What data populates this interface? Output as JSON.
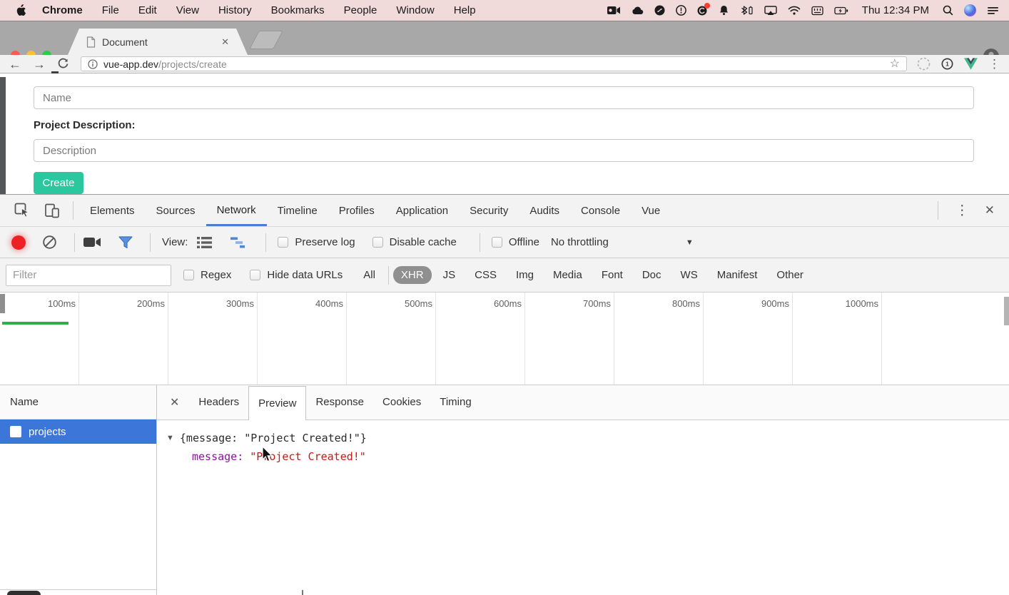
{
  "menubar": {
    "items": [
      "Chrome",
      "File",
      "Edit",
      "View",
      "History",
      "Bookmarks",
      "People",
      "Window",
      "Help"
    ],
    "time": "Thu 12:34 PM",
    "status_icons": [
      "screen-record-icon",
      "cloud-icon",
      "shazam-icon",
      "alert-circle-icon",
      "app-badge-icon",
      "bell-icon",
      "bluetooth-battery-icon",
      "airplay-display-icon",
      "wifi-icon",
      "keyboard-icon",
      "battery-charging-icon",
      "spotlight-search-icon",
      "siri-icon",
      "notification-center-icon"
    ]
  },
  "browser": {
    "tab_title": "Document",
    "url_host": "vue-app.dev",
    "url_path": "/projects/create"
  },
  "page": {
    "name_placeholder": "Name",
    "description_label": "Project Description:",
    "description_placeholder": "Description",
    "create_button": "Create",
    "create_button_color": "#2bc79e"
  },
  "devtools": {
    "tabs": [
      "Elements",
      "Sources",
      "Network",
      "Timeline",
      "Profiles",
      "Application",
      "Security",
      "Audits",
      "Console",
      "Vue"
    ],
    "active_tab": "Network",
    "active_tab_underline_color": "#4c7dd2",
    "toolbar": {
      "view_label": "View:",
      "preserve_log": "Preserve log",
      "disable_cache": "Disable cache",
      "offline": "Offline",
      "throttling": "No throttling"
    },
    "filter": {
      "placeholder": "Filter",
      "regex": "Regex",
      "hide_data_urls": "Hide data URLs",
      "all": "All",
      "types": [
        "XHR",
        "JS",
        "CSS",
        "Img",
        "Media",
        "Font",
        "Doc",
        "WS",
        "Manifest",
        "Other"
      ],
      "active_type": "XHR"
    },
    "ruler_labels": [
      "100ms",
      "200ms",
      "300ms",
      "400ms",
      "500ms",
      "600ms",
      "700ms",
      "800ms",
      "900ms",
      "1000ms"
    ],
    "overview_bar_color": "#2fae49",
    "requests": {
      "name_header": "Name",
      "rows": [
        {
          "name": "projects",
          "selected": true
        }
      ],
      "selection_color": "#3b76d8"
    },
    "detail_tabs": [
      "Headers",
      "Preview",
      "Response",
      "Cookies",
      "Timing"
    ],
    "active_detail_tab": "Preview",
    "preview": {
      "summary": "{message: \"Project Created!\"}",
      "key": "message:",
      "value": "\"Project Created!\"",
      "key_color": "#8b1399",
      "value_color": "#c41a16"
    }
  }
}
